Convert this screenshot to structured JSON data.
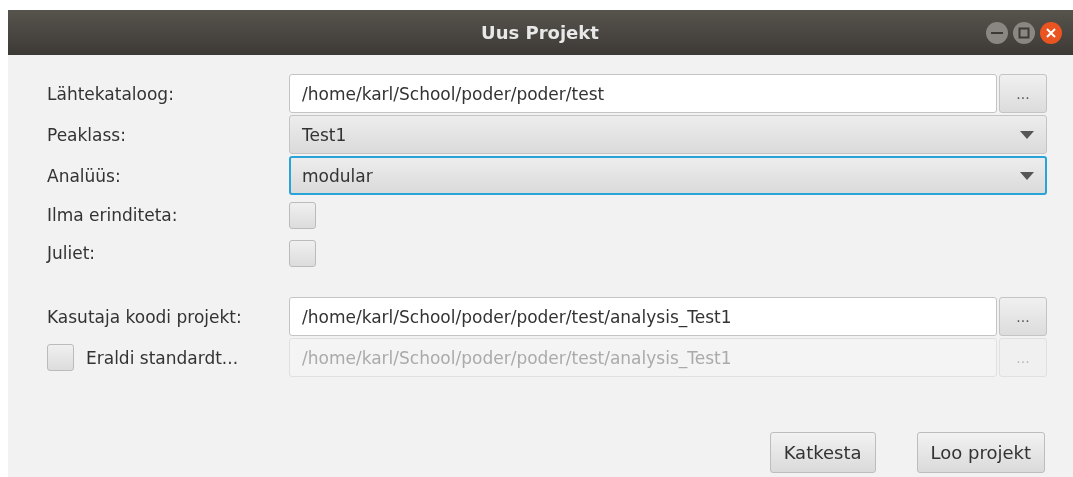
{
  "window": {
    "title": "Uus Projekt"
  },
  "rows": [
    {
      "kind": "path",
      "label": "Lähtekataloog:",
      "value": "/home/karl/School/poder/poder/test",
      "button": "...",
      "disabled": false
    },
    {
      "kind": "combo",
      "label": "Peaklass:",
      "value": "Test1",
      "focused": false
    },
    {
      "kind": "combo",
      "label": "Analüüs:",
      "value": "modular",
      "focused": true
    },
    {
      "kind": "check",
      "label": "Ilma erinditeta:",
      "checked": false
    },
    {
      "kind": "check",
      "label": "Juliet:",
      "checked": false
    }
  ],
  "project_rows": [
    {
      "kind": "path",
      "label": "Kasutaja koodi projekt:",
      "value": "/home/karl/School/poder/poder/test/analysis_Test1",
      "button": "...",
      "disabled": false
    },
    {
      "kind": "checkpath",
      "label": "Eraldi standardt...",
      "checked": false,
      "value": "/home/karl/School/poder/poder/test/analysis_Test1",
      "button": "...",
      "disabled": true
    }
  ],
  "buttons": [
    "Katkesta",
    "Loo projekt"
  ]
}
